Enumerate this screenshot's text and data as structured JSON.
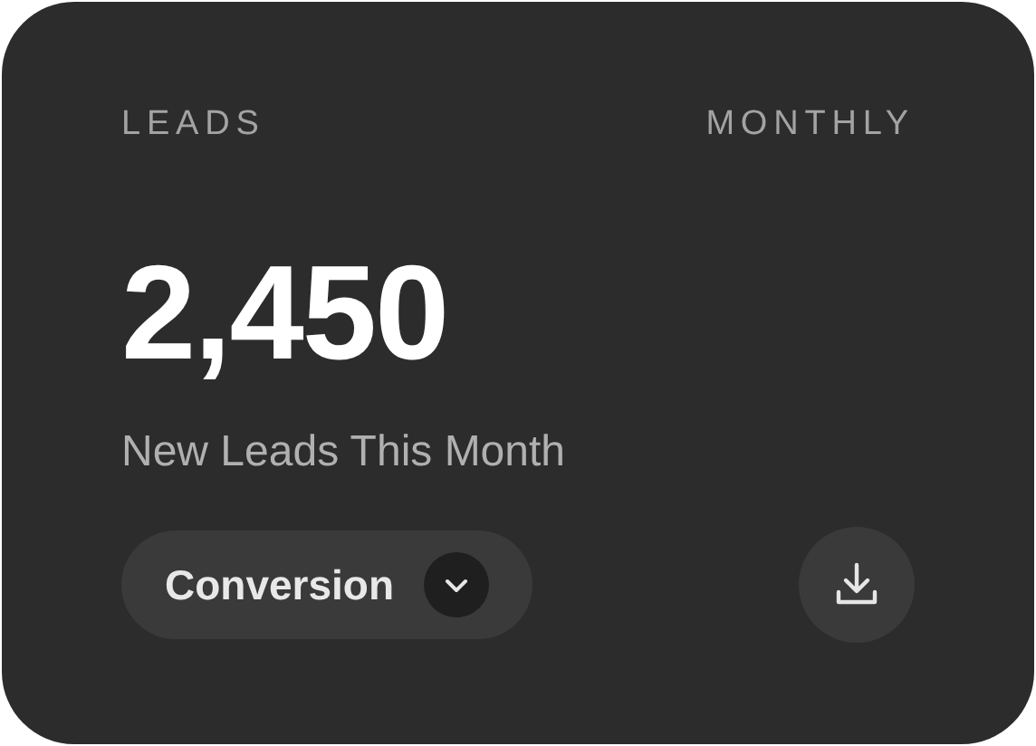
{
  "card": {
    "label": "LEADS",
    "period": "MONTHLY",
    "value": "2,450",
    "caption": "New Leads This Month",
    "dropdown": {
      "value": "Conversion"
    },
    "actions": [
      {
        "kind": "download"
      }
    ]
  }
}
